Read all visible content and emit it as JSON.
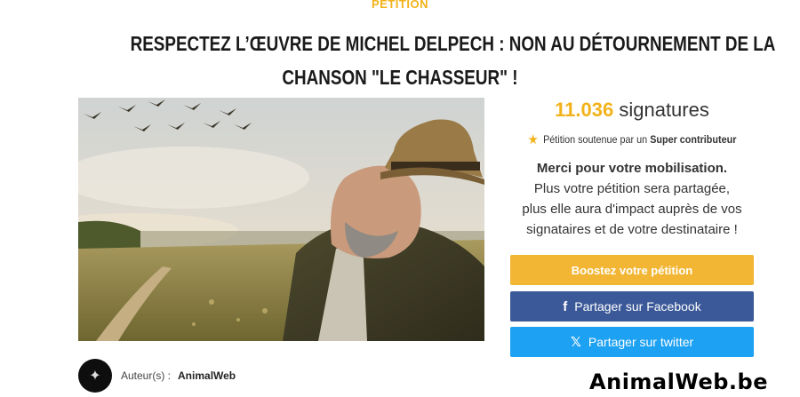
{
  "kicker": "PÉTITION",
  "title": {
    "line1": "RESPECTEZ L’ŒUVRE DE MICHEL DELPECH : NON AU DÉTOURNEMENT DE LA",
    "line2": "CHANSON \"LE CHASSEUR\" !"
  },
  "signatures": {
    "count": "11.036",
    "label": "signatures"
  },
  "support": {
    "icon": "star-icon",
    "prefix": "Pétition soutenue par un",
    "highlight": "Super contributeur"
  },
  "thanks": {
    "headline": "Merci pour votre mobilisation.",
    "line1": "Plus votre pétition sera partagée,",
    "line2": "plus elle aura d'impact auprès de vos",
    "line3": "signataires et de votre destinataire !"
  },
  "buttons": {
    "boost": "Boostez votre pétition",
    "facebook": "Partager sur Facebook",
    "twitter": "Partager sur twitter"
  },
  "author": {
    "label": "Auteur(s) :",
    "name": "AnimalWeb"
  },
  "watermark": "AnimalWeb.be",
  "colors": {
    "accent": "#f2b21a",
    "facebook": "#3b5998",
    "twitter": "#1da1f2"
  }
}
